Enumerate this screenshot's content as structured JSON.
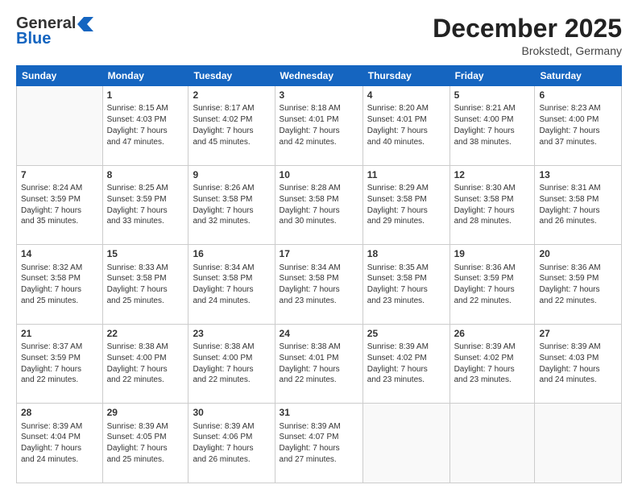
{
  "header": {
    "logo_general": "General",
    "logo_blue": "Blue",
    "month_title": "December 2025",
    "location": "Brokstedt, Germany"
  },
  "weekdays": [
    "Sunday",
    "Monday",
    "Tuesday",
    "Wednesday",
    "Thursday",
    "Friday",
    "Saturday"
  ],
  "weeks": [
    [
      {
        "day": "",
        "content": ""
      },
      {
        "day": "1",
        "content": "Sunrise: 8:15 AM\nSunset: 4:03 PM\nDaylight: 7 hours\nand 47 minutes."
      },
      {
        "day": "2",
        "content": "Sunrise: 8:17 AM\nSunset: 4:02 PM\nDaylight: 7 hours\nand 45 minutes."
      },
      {
        "day": "3",
        "content": "Sunrise: 8:18 AM\nSunset: 4:01 PM\nDaylight: 7 hours\nand 42 minutes."
      },
      {
        "day": "4",
        "content": "Sunrise: 8:20 AM\nSunset: 4:01 PM\nDaylight: 7 hours\nand 40 minutes."
      },
      {
        "day": "5",
        "content": "Sunrise: 8:21 AM\nSunset: 4:00 PM\nDaylight: 7 hours\nand 38 minutes."
      },
      {
        "day": "6",
        "content": "Sunrise: 8:23 AM\nSunset: 4:00 PM\nDaylight: 7 hours\nand 37 minutes."
      }
    ],
    [
      {
        "day": "7",
        "content": "Sunrise: 8:24 AM\nSunset: 3:59 PM\nDaylight: 7 hours\nand 35 minutes."
      },
      {
        "day": "8",
        "content": "Sunrise: 8:25 AM\nSunset: 3:59 PM\nDaylight: 7 hours\nand 33 minutes."
      },
      {
        "day": "9",
        "content": "Sunrise: 8:26 AM\nSunset: 3:58 PM\nDaylight: 7 hours\nand 32 minutes."
      },
      {
        "day": "10",
        "content": "Sunrise: 8:28 AM\nSunset: 3:58 PM\nDaylight: 7 hours\nand 30 minutes."
      },
      {
        "day": "11",
        "content": "Sunrise: 8:29 AM\nSunset: 3:58 PM\nDaylight: 7 hours\nand 29 minutes."
      },
      {
        "day": "12",
        "content": "Sunrise: 8:30 AM\nSunset: 3:58 PM\nDaylight: 7 hours\nand 28 minutes."
      },
      {
        "day": "13",
        "content": "Sunrise: 8:31 AM\nSunset: 3:58 PM\nDaylight: 7 hours\nand 26 minutes."
      }
    ],
    [
      {
        "day": "14",
        "content": "Sunrise: 8:32 AM\nSunset: 3:58 PM\nDaylight: 7 hours\nand 25 minutes."
      },
      {
        "day": "15",
        "content": "Sunrise: 8:33 AM\nSunset: 3:58 PM\nDaylight: 7 hours\nand 25 minutes."
      },
      {
        "day": "16",
        "content": "Sunrise: 8:34 AM\nSunset: 3:58 PM\nDaylight: 7 hours\nand 24 minutes."
      },
      {
        "day": "17",
        "content": "Sunrise: 8:34 AM\nSunset: 3:58 PM\nDaylight: 7 hours\nand 23 minutes."
      },
      {
        "day": "18",
        "content": "Sunrise: 8:35 AM\nSunset: 3:58 PM\nDaylight: 7 hours\nand 23 minutes."
      },
      {
        "day": "19",
        "content": "Sunrise: 8:36 AM\nSunset: 3:59 PM\nDaylight: 7 hours\nand 22 minutes."
      },
      {
        "day": "20",
        "content": "Sunrise: 8:36 AM\nSunset: 3:59 PM\nDaylight: 7 hours\nand 22 minutes."
      }
    ],
    [
      {
        "day": "21",
        "content": "Sunrise: 8:37 AM\nSunset: 3:59 PM\nDaylight: 7 hours\nand 22 minutes."
      },
      {
        "day": "22",
        "content": "Sunrise: 8:38 AM\nSunset: 4:00 PM\nDaylight: 7 hours\nand 22 minutes."
      },
      {
        "day": "23",
        "content": "Sunrise: 8:38 AM\nSunset: 4:00 PM\nDaylight: 7 hours\nand 22 minutes."
      },
      {
        "day": "24",
        "content": "Sunrise: 8:38 AM\nSunset: 4:01 PM\nDaylight: 7 hours\nand 22 minutes."
      },
      {
        "day": "25",
        "content": "Sunrise: 8:39 AM\nSunset: 4:02 PM\nDaylight: 7 hours\nand 23 minutes."
      },
      {
        "day": "26",
        "content": "Sunrise: 8:39 AM\nSunset: 4:02 PM\nDaylight: 7 hours\nand 23 minutes."
      },
      {
        "day": "27",
        "content": "Sunrise: 8:39 AM\nSunset: 4:03 PM\nDaylight: 7 hours\nand 24 minutes."
      }
    ],
    [
      {
        "day": "28",
        "content": "Sunrise: 8:39 AM\nSunset: 4:04 PM\nDaylight: 7 hours\nand 24 minutes."
      },
      {
        "day": "29",
        "content": "Sunrise: 8:39 AM\nSunset: 4:05 PM\nDaylight: 7 hours\nand 25 minutes."
      },
      {
        "day": "30",
        "content": "Sunrise: 8:39 AM\nSunset: 4:06 PM\nDaylight: 7 hours\nand 26 minutes."
      },
      {
        "day": "31",
        "content": "Sunrise: 8:39 AM\nSunset: 4:07 PM\nDaylight: 7 hours\nand 27 minutes."
      },
      {
        "day": "",
        "content": ""
      },
      {
        "day": "",
        "content": ""
      },
      {
        "day": "",
        "content": ""
      }
    ]
  ]
}
